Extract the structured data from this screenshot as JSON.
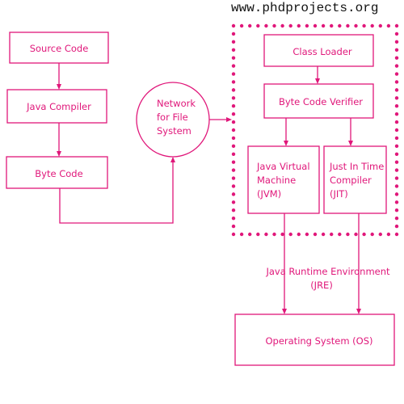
{
  "watermark": "www.phdprojects.org",
  "colors": {
    "accent": "#E0177A",
    "watermark": "#111111",
    "background": "#ffffff"
  },
  "nodes": {
    "source_code": {
      "label": [
        "Source Code"
      ]
    },
    "java_compiler": {
      "label": [
        "Java Compiler"
      ]
    },
    "byte_code": {
      "label": [
        "Byte Code"
      ]
    },
    "network": {
      "label": [
        "Network",
        "for File",
        "System"
      ]
    },
    "class_loader": {
      "label": [
        "Class Loader"
      ]
    },
    "byte_code_verifier": {
      "label": [
        "Byte Code Verifier"
      ]
    },
    "jvm": {
      "label": [
        "Java Virtual",
        "Machine",
        "(JVM)"
      ]
    },
    "jit": {
      "label": [
        "Just In Time",
        "Compiler",
        "(JIT)"
      ]
    },
    "os": {
      "label": [
        "Operating System (OS)"
      ]
    }
  },
  "group_label": [
    "Java Runtime Environment",
    "(JRE)"
  ],
  "edges": [
    {
      "from": "source_code",
      "to": "java_compiler"
    },
    {
      "from": "java_compiler",
      "to": "byte_code"
    },
    {
      "from": "byte_code",
      "to": "network"
    },
    {
      "from": "network",
      "to": "jre_group"
    },
    {
      "from": "class_loader",
      "to": "byte_code_verifier"
    },
    {
      "from": "byte_code_verifier",
      "to": "jvm"
    },
    {
      "from": "byte_code_verifier",
      "to": "jit"
    },
    {
      "from": "jvm",
      "to": "os"
    },
    {
      "from": "jit",
      "to": "os"
    }
  ]
}
